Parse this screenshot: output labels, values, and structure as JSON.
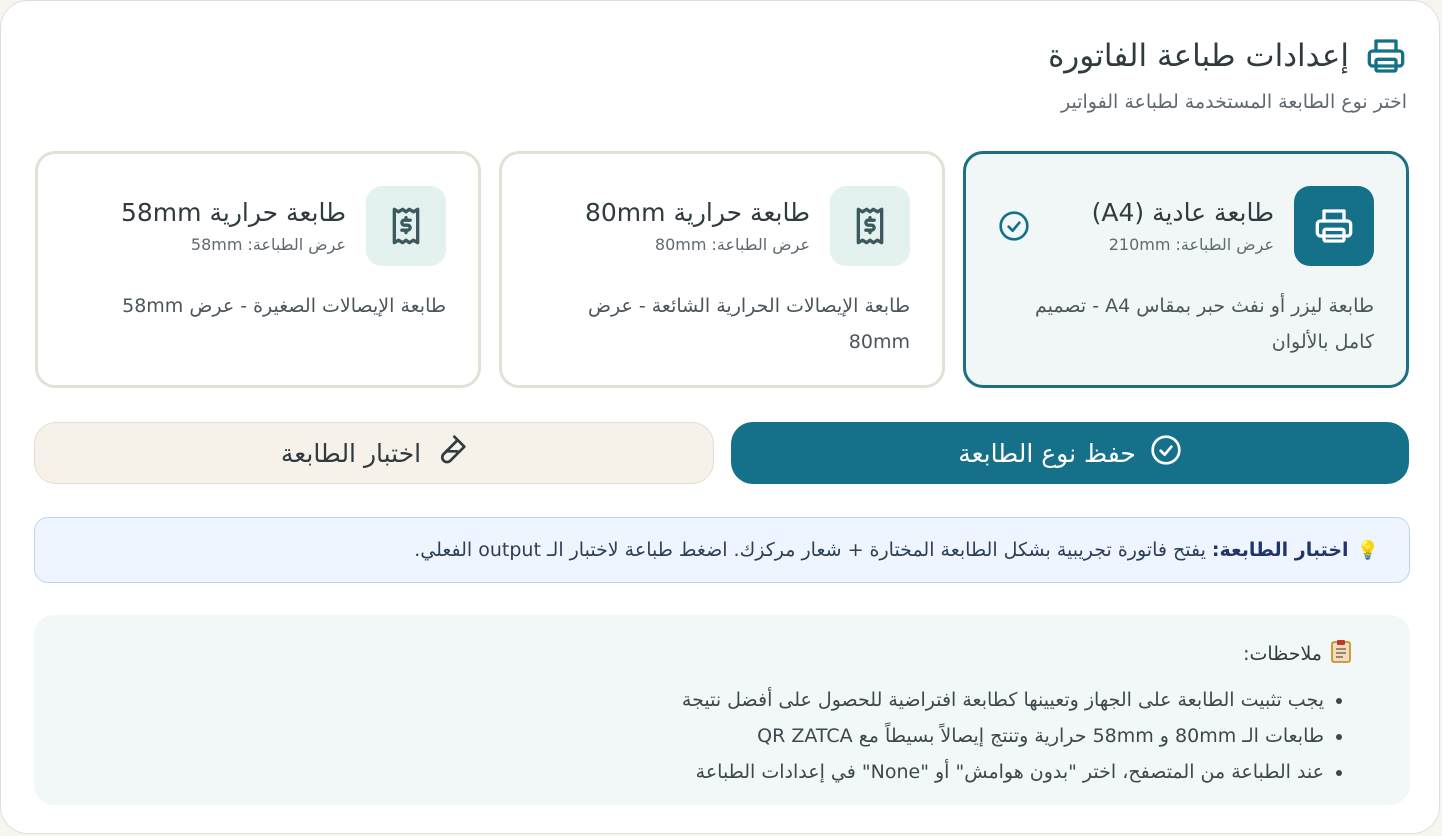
{
  "header": {
    "title": "إعدادات طباعة الفاتورة",
    "subtitle": "اختر نوع الطابعة المستخدمة لطباعة الفواتير",
    "icon": "printer-icon"
  },
  "printers": [
    {
      "name": "طابعة عادية (A4)",
      "width_label": "عرض الطباعة: 210mm",
      "description": "طابعة ليزر أو نفث حبر بمقاس A4 - تصميم كامل بالألوان",
      "icon": "printer-icon",
      "selected": true
    },
    {
      "name": "طابعة حرارية 80mm",
      "width_label": "عرض الطباعة: 80mm",
      "description": "طابعة الإيصالات الحرارية الشائعة - عرض 80mm",
      "icon": "receipt-icon",
      "selected": false
    },
    {
      "name": "طابعة حرارية 58mm",
      "width_label": "عرض الطباعة: 58mm",
      "description": "طابعة الإيصالات الصغيرة - عرض 58mm",
      "icon": "receipt-icon",
      "selected": false
    }
  ],
  "actions": {
    "save_label": "حفظ نوع الطابعة",
    "test_label": "اختبار الطابعة"
  },
  "info": {
    "label": "اختبار الطابعة:",
    "text": "يفتح فاتورة تجريبية بشكل الطابعة المختارة + شعار مركزك. اضغط طباعة لاختبار الـ output الفعلي."
  },
  "notes": {
    "title": "ملاحظات:",
    "items": [
      "يجب تثبيت الطابعة على الجهاز وتعيينها كطابعة افتراضية للحصول على أفضل نتيجة",
      "طابعات الـ 80mm و 58mm حرارية وتنتج إيصالاً بسيطاً مع QR ZATCA",
      "عند الطباعة من المتصفح، اختر \"بدون هوامش\" أو \"None\" في إعدادات الطباعة"
    ]
  },
  "colors": {
    "accent": "#157189",
    "selected_border": "#1d6f84",
    "icon_bg": "#e3f1ef",
    "info_bg": "#eef5fe",
    "notes_bg": "#f2f8f7"
  }
}
